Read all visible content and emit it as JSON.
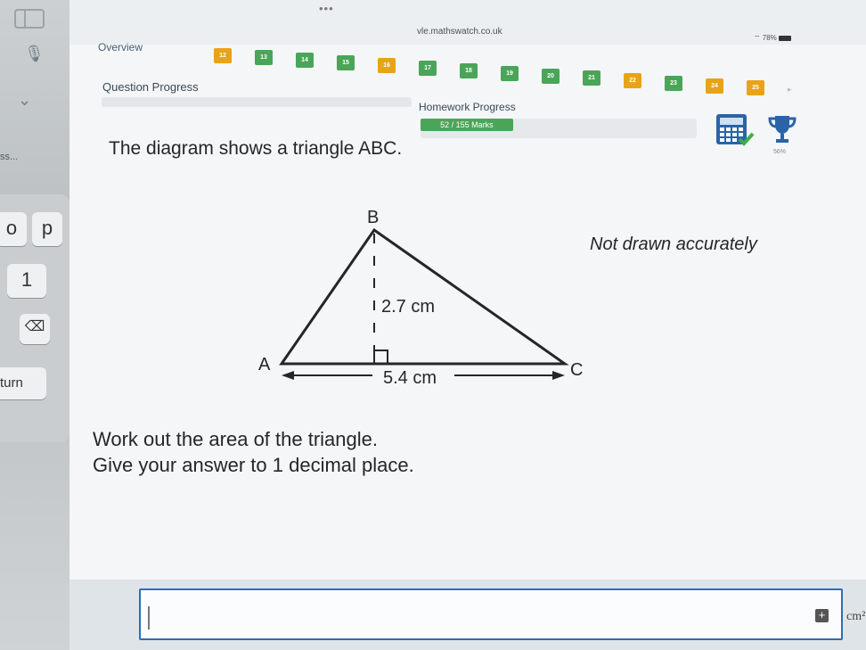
{
  "side": {
    "truncated_label": "ss...",
    "keys": {
      "o": "o",
      "p": "p",
      "one": "1",
      "delete": "⌫",
      "return": "turn"
    }
  },
  "browser": {
    "dots": "•••",
    "url": "vle.mathswatch.co.uk",
    "battery": "78%"
  },
  "nav": {
    "overview": "Overview",
    "question_numbers": [
      {
        "n": "12",
        "color": "#e8a317"
      },
      {
        "n": "13",
        "color": "#4aa558"
      },
      {
        "n": "14",
        "color": "#4aa558"
      },
      {
        "n": "15",
        "color": "#4aa558"
      },
      {
        "n": "16",
        "color": "#e8a317"
      },
      {
        "n": "17",
        "color": "#4aa558"
      },
      {
        "n": "18",
        "color": "#4aa558"
      },
      {
        "n": "19",
        "color": "#4aa558"
      },
      {
        "n": "20",
        "color": "#4aa558"
      },
      {
        "n": "21",
        "color": "#4aa558"
      },
      {
        "n": "22",
        "color": "#e8a317"
      },
      {
        "n": "23",
        "color": "#4aa558"
      },
      {
        "n": "24",
        "color": "#e8a317"
      },
      {
        "n": "25",
        "color": "#e8a317"
      }
    ]
  },
  "progress": {
    "question_label": "Question Progress",
    "homework_label": "Homework Progress",
    "homework_marks": "52 / 155 Marks",
    "homework_fraction": 0.335,
    "trophy_pct": "56%"
  },
  "question": {
    "title": "The diagram shows a triangle ABC.",
    "not_accurate": "Not drawn accurately",
    "instruction1": "Work out the area of the triangle.",
    "instruction2": "Give your answer to 1 decimal place."
  },
  "diagram": {
    "vertex_a": "A",
    "vertex_b": "B",
    "vertex_c": "C",
    "height_label": "2.7 cm",
    "base_label": "5.4 cm"
  },
  "answer": {
    "value": "",
    "unit": "cm²"
  },
  "colors": {
    "green": "#4aa558",
    "orange": "#e8a317",
    "input_border": "#2d6eb7"
  }
}
